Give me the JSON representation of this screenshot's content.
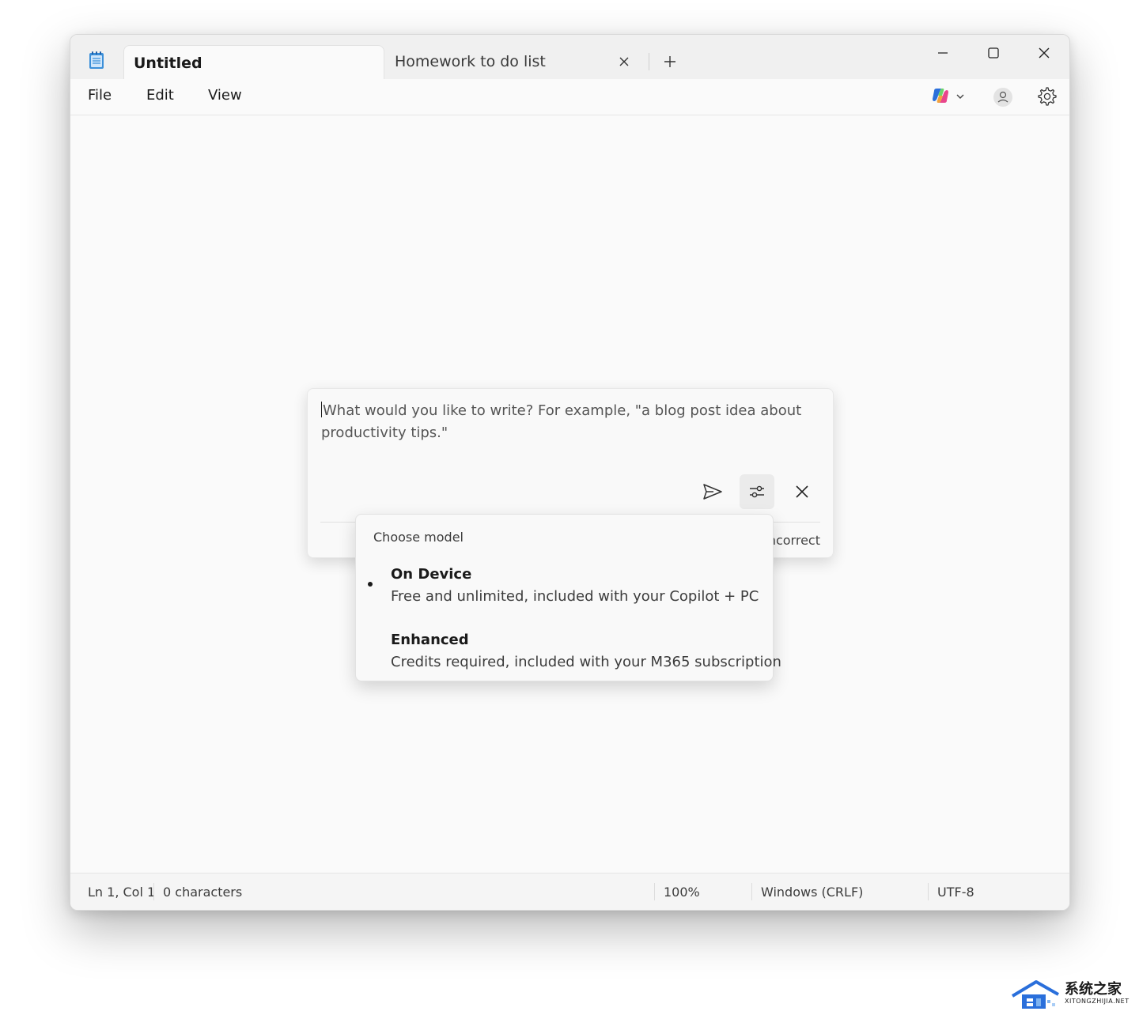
{
  "tabs": [
    {
      "label": "Untitled",
      "active": true
    },
    {
      "label": "Homework to do list",
      "active": false
    }
  ],
  "menu": {
    "file": "File",
    "edit": "Edit",
    "view": "View"
  },
  "icons": {
    "app": "notepad-icon",
    "tab_close": "close-icon",
    "new_tab": "plus-icon",
    "minimize": "minimize-icon",
    "maximize": "maximize-icon",
    "window_close": "close-icon",
    "copilot": "copilot-icon",
    "account": "account-icon",
    "settings": "gear-icon",
    "send": "send-icon",
    "options": "sliders-icon",
    "compose_close": "close-icon"
  },
  "compose": {
    "placeholder": "What would you like to write? For example, \"a blog post idea about productivity tips.\"",
    "disclaimer_partial": "ncorrect"
  },
  "model_menu": {
    "heading": "Choose model",
    "options": [
      {
        "title": "On Device",
        "description": "Free and unlimited, included with your Copilot + PC",
        "selected": true
      },
      {
        "title": "Enhanced",
        "description": "Credits required, included with your M365 subscription",
        "selected": false
      }
    ]
  },
  "status": {
    "position": "Ln 1, Col 1",
    "characters": "0 characters",
    "zoom": "100%",
    "line_ending": "Windows (CRLF)",
    "encoding": "UTF-8"
  },
  "watermark": {
    "name_cn": "系统之家",
    "url": "XITONGZHIJIA.NET"
  },
  "colors": {
    "accent_blue": "#2a6fdb",
    "window_bg": "#fafafa",
    "titlebar_bg": "#f0f0f0"
  }
}
